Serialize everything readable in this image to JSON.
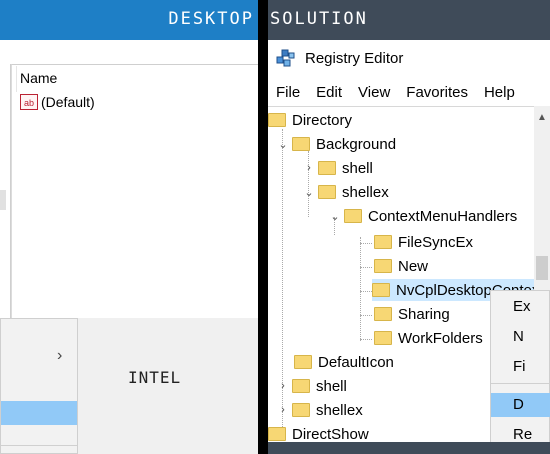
{
  "left_panel": {
    "banner_text": "DESKTOP",
    "column_header": "Name",
    "value_row": {
      "icon": "string-value-icon",
      "icon_text": "ab",
      "name": "(Default)"
    },
    "menu": {
      "submenu_arrow": "›"
    },
    "brand_label": "INTEL"
  },
  "right_panel": {
    "banner_text": "SOLUTION",
    "app_title": "Registry Editor",
    "menu": [
      "File",
      "Edit",
      "View",
      "Favorites",
      "Help"
    ],
    "tree": [
      "Directory",
      "Background",
      "shell",
      "shellex",
      "ContextMenuHandlers",
      "FileSyncEx",
      "New",
      "NvCplDesktopContext",
      "Sharing",
      "WorkFolders",
      "DefaultIcon",
      "shell",
      "shellex",
      "DirectShow"
    ],
    "context_menu": [
      "Ex",
      "N",
      "Fi",
      "D",
      "Re"
    ],
    "colors": {
      "accent": "#1e7fc6",
      "highlight": "#91c9f7",
      "selected": "#cce8ff",
      "folder": "#f7d774",
      "banner_dark": "#3f4b59"
    }
  }
}
